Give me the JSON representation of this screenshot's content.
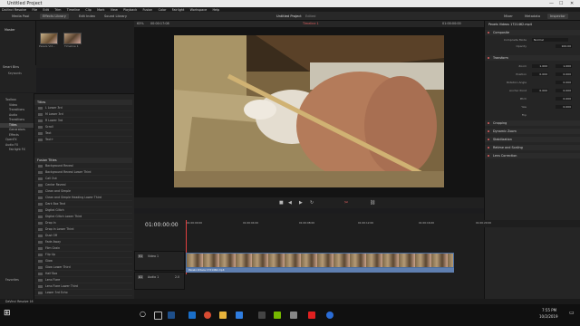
{
  "window": {
    "title": "Untitled Project",
    "min": "—",
    "max": "☐",
    "close": "✕"
  },
  "menu": [
    "DaVinci Resolve",
    "File",
    "Edit",
    "Trim",
    "Timeline",
    "Clip",
    "Mark",
    "View",
    "Playback",
    "Fusion",
    "Color",
    "Fairlight",
    "Workspace",
    "Help"
  ],
  "toolbar": {
    "media_pool": "Media Pool",
    "effects_library": "Effects Library",
    "edit_index": "Edit Index",
    "sound_library": "Sound Library",
    "project_title": "Untitled Project",
    "edited": "Edited",
    "mixer": "Mixer",
    "metadata": "Metadata",
    "inspector": "Inspector"
  },
  "media_pool": {
    "master": "Master",
    "clips": [
      {
        "name": "Pexels Vid..."
      },
      {
        "name": "Timeline 1"
      }
    ],
    "smart_bins": "Smart Bins",
    "keywords": "Keywords",
    "favorites": "Favorites"
  },
  "viewer": {
    "zoom": "63%",
    "timecode_left": "00:00:17:08",
    "timeline_name": "Timeline 1",
    "timecode_right": "01:00:00:00"
  },
  "effects_tree": [
    "Toolbox",
    "Video Transitions",
    "Audio Transitions",
    "Titles",
    "Generators",
    "Effects",
    "OpenFX",
    "Audio FX",
    "Fairlight FX"
  ],
  "effects_tree_selected": "Titles",
  "titles_section": {
    "header": "Titles",
    "items": [
      "L Lower 3rd",
      "M Lower 3rd",
      "R Lower 3rd",
      "Scroll",
      "Text",
      "Text+"
    ]
  },
  "fusion_section": {
    "header": "Fusion Titles",
    "items": [
      "Background Reveal",
      "Background Reveal Lower Third",
      "Call Out",
      "Center Reveal",
      "Clean and Simple",
      "Clean and Simple Heading Lower Third",
      "Dark Box Text",
      "Digital Glitch",
      "Digital Glitch Lower Third",
      "Drop In",
      "Drop In Lower Third",
      "Dust Off",
      "Fade Away",
      "Film Grain",
      "Flip Up",
      "Glow",
      "Glow Lower Third",
      "Half Box",
      "Lens Flare",
      "Lens Flare Lower Third",
      "Lower 3rd Echo"
    ]
  },
  "inspector": {
    "clip_name": "Pexels Videos 1721462.mp4",
    "composite": "Composite",
    "composite_mode_label": "Composite Mode",
    "composite_mode": "Normal",
    "opacity_label": "Opacity",
    "opacity": "100.00",
    "transform": "Transform",
    "props": [
      {
        "label": "Zoom",
        "x": "1.000",
        "y": "1.000"
      },
      {
        "label": "Position",
        "x": "0.000",
        "y": "0.000"
      },
      {
        "label": "Rotation Angle",
        "x": "0.000",
        "y": ""
      },
      {
        "label": "Anchor Point",
        "x": "0.000",
        "y": "0.000"
      },
      {
        "label": "Pitch",
        "x": "0.000",
        "y": ""
      },
      {
        "label": "Yaw",
        "x": "0.000",
        "y": ""
      },
      {
        "label": "Flip",
        "x": "",
        "y": ""
      }
    ],
    "sections": [
      "Cropping",
      "Dynamic Zoom",
      "Stabilization",
      "Retime and Scaling",
      "Lens Correction"
    ]
  },
  "timeline": {
    "timecode": "01:00:00:00",
    "ruler": [
      "01:00:00:00",
      "01:00:04:00",
      "01:00:08:00",
      "01:00:12:00",
      "01:00:16:00",
      "01:00:20:00"
    ],
    "video_track": "Video 1",
    "video_track_id": "V1",
    "audio_track": "Audio 1",
    "audio_track_id": "A1",
    "audio_level": "2.0",
    "clip_name": "Pexels Videos 1721462.mp4"
  },
  "status": {
    "app": "DaVinci Resolve 16"
  },
  "taskbar": {
    "time": "7:55 PM",
    "date": "10/2/2019"
  }
}
